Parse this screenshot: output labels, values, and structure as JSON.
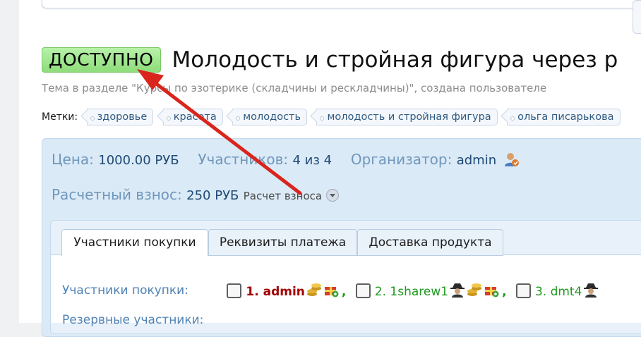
{
  "thread": {
    "prefix": "ДОСТУПНО",
    "title": "Молодость и стройная фигура через р",
    "meta": "Тема в разделе \"Курсы по эзотерике (складчины и рескладчины)\", создана пользователе"
  },
  "tags": {
    "label": "Метки:",
    "items": [
      "здоровье",
      "красота",
      "молодость",
      "молодость и стройная фигура",
      "ольга писарькова"
    ]
  },
  "info": {
    "price_label": "Цена:",
    "price_value": "1000.00 РУБ",
    "participants_label": "Участников:",
    "participants_value": "4 из 4",
    "organizer_label": "Организатор:",
    "organizer_value": "admin",
    "fee_label": "Расчетный взнос:",
    "fee_value": "250 РУБ",
    "fee_calc_link": "Расчет взноса"
  },
  "tabs": [
    {
      "label": "Участники покупки",
      "active": true
    },
    {
      "label": "Реквизиты платежа",
      "active": false
    },
    {
      "label": "Доставка продукта",
      "active": false
    }
  ],
  "buyers": {
    "label": "Участники покупки:",
    "items": [
      {
        "name": "1. admin",
        "sep": ","
      },
      {
        "name": "2. 1sharew1",
        "sep": ","
      },
      {
        "name": "3. dmt4",
        "sep": ""
      }
    ],
    "next_row_label": "Резервные участники:"
  },
  "colors": {
    "prefix_bg": "#9be489",
    "panel_bg": "#dbeaf7",
    "label_blue": "#6f97bb",
    "value_blue": "#1f4a74",
    "annotation_arrow": "#d9251c"
  },
  "icons": [
    "user-icon",
    "coins-icon",
    "gift-icon",
    "spy-icon",
    "dropdown-icon"
  ]
}
